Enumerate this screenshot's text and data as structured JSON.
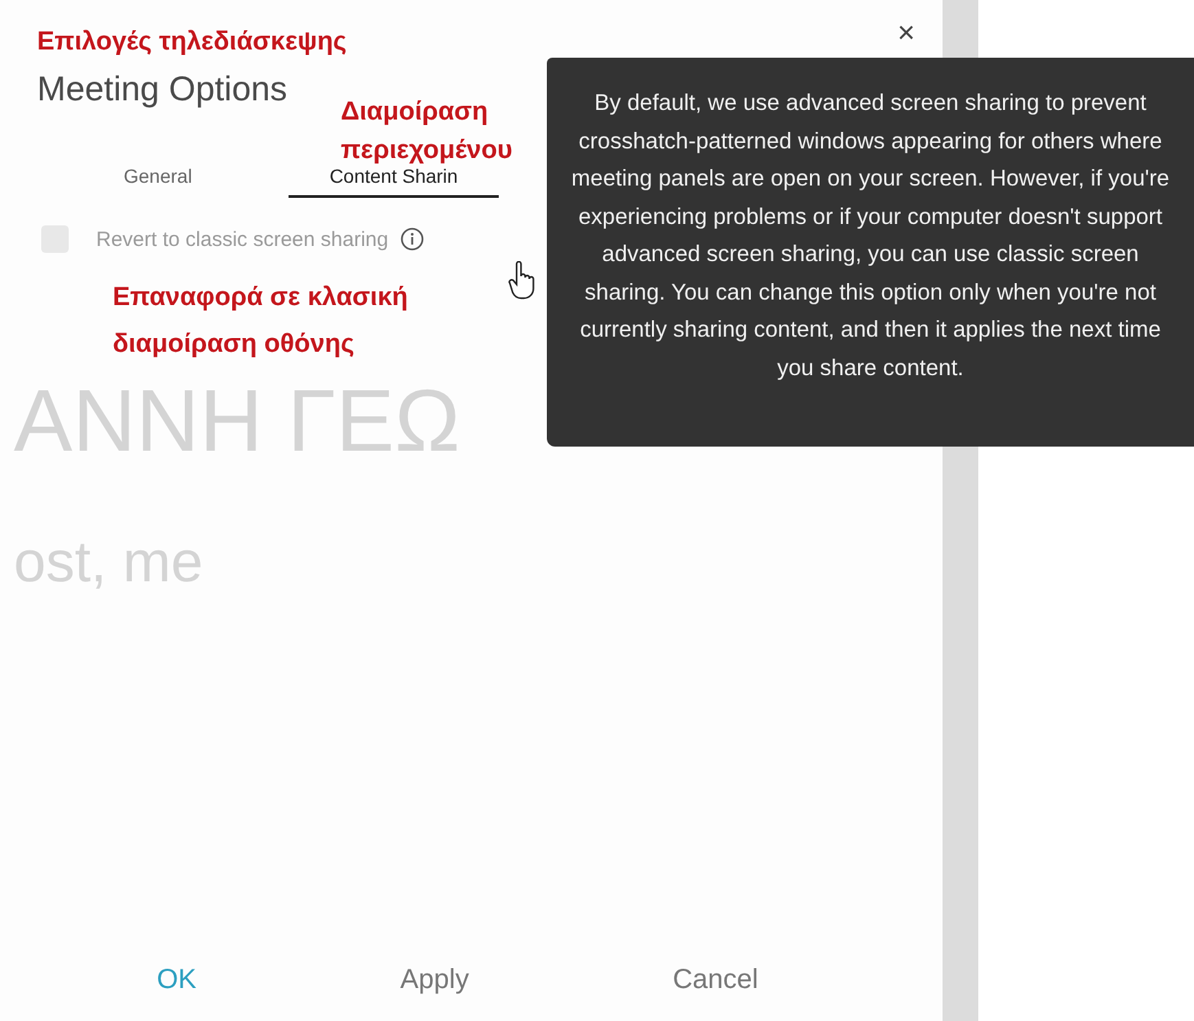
{
  "dialog": {
    "title": "Meeting Options",
    "close": "×",
    "tabs": [
      {
        "label": "General",
        "selected": false
      },
      {
        "label": "Content Sharin",
        "selected": true
      }
    ],
    "option": {
      "label": "Revert to classic screen sharing",
      "checked": false,
      "disabled": true
    },
    "background_text": [
      "ΑΝΝΗ ΓΕΩ",
      "ost, me"
    ],
    "buttons": [
      {
        "label": "OK",
        "kind": "primary"
      },
      {
        "label": "Apply",
        "kind": "secondary"
      },
      {
        "label": "Cancel",
        "kind": "secondary"
      }
    ]
  },
  "tooltip": {
    "text": "By default, we use advanced screen sharing to prevent crosshatch-patterned windows appearing for others where meeting panels are open on your screen. However, if you're experiencing problems or if your computer doesn't support advanced screen sharing, you can use classic screen sharing. You can change this option only when you're not currently sharing content, and then it applies the next time you share content."
  },
  "annotations": [
    {
      "text": "Επιλογές τηλεδιάσκεψης"
    },
    {
      "text": "Διαμοίραση περιεχομένου"
    },
    {
      "text": "Επαναφορά σε κλασική διαμοίραση οθόνης"
    }
  ]
}
